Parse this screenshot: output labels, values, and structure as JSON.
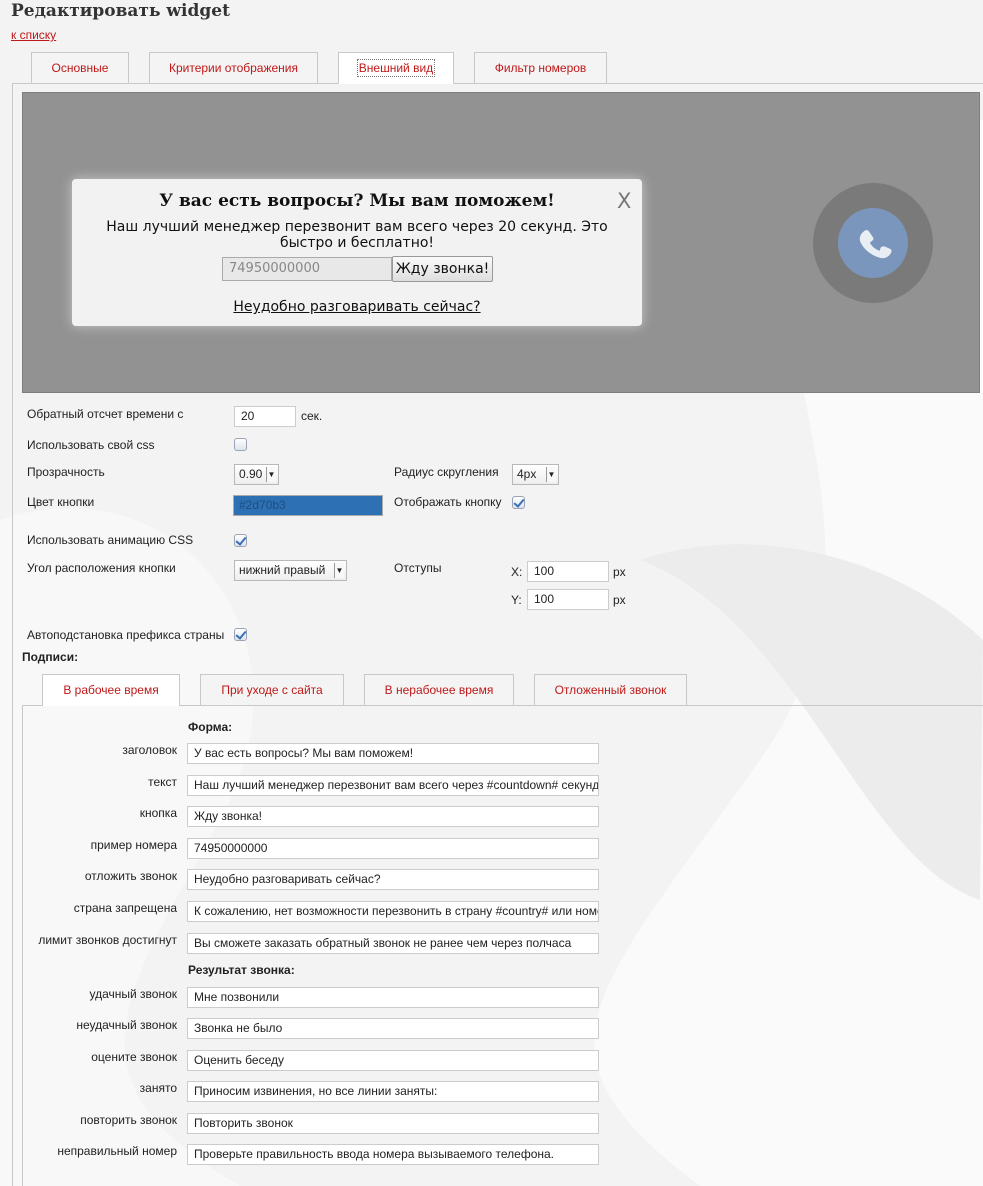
{
  "page": {
    "title": "Редактировать widget",
    "back_link": "к списку"
  },
  "tabs": [
    "Основные",
    "Критерии отображения",
    "Внешний вид",
    "Фильтр номеров"
  ],
  "preview": {
    "title": "У вас есть вопросы? Мы вам поможем!",
    "text": "Наш лучший менеджер перезвонит вам всего через 20 секунд. Это быстро и бесплатно!",
    "phone_placeholder": "74950000000",
    "submit": "Жду звонка!",
    "later": "Неудобно разговаривать сейчас?",
    "close": "X",
    "call_icon": "phone-icon"
  },
  "settings": {
    "countdown_label": "Обратный отсчет времени с",
    "countdown_value": "20",
    "countdown_unit": "сек.",
    "custom_css_label": "Использовать свой css",
    "custom_css_checked": false,
    "opacity_label": "Прозрачность",
    "opacity_value": "0.90",
    "radius_label": "Радиус скругления",
    "radius_value": "4px",
    "color_label": "Цвет кнопки",
    "color_value": "#2d70b3",
    "show_button_label": "Отображать кнопку",
    "show_button_checked": true,
    "animation_label": "Использовать анимацию CSS",
    "animation_checked": true,
    "corner_label": "Угол расположения кнопки",
    "corner_value": "нижний правый",
    "offsets_label": "Отступы",
    "x_label": "X:",
    "x_value": "100",
    "y_label": "Y:",
    "y_value": "100",
    "px": "px",
    "autoprefix_label": "Автоподстановка префикса страны",
    "autoprefix_checked": true
  },
  "captions": {
    "title": "Подписи:",
    "tabs": [
      "В рабочее время",
      "При уходе с сайта",
      "В нерабочее время",
      "Отложенный звонок"
    ],
    "form_title": "Форма:",
    "form": [
      {
        "label": "заголовок",
        "value": "У вас есть вопросы? Мы вам поможем!"
      },
      {
        "label": "текст",
        "value": "Наш лучший менеджер перезвонит вам всего через #countdown# секунд. Это быстро и бесплатно!"
      },
      {
        "label": "кнопка",
        "value": "Жду звонка!"
      },
      {
        "label": "пример номера",
        "value": "74950000000"
      },
      {
        "label": "отложить звонок",
        "value": "Неудобно разговаривать сейчас?"
      },
      {
        "label": "страна запрещена",
        "value": "К сожалению, нет возможности перезвонить в страну #country# или номер"
      },
      {
        "label": "лимит звонков достигнут",
        "value": "Вы сможете заказать обратный звонок не ранее чем через полчаса"
      }
    ],
    "result_title": "Результат звонка:",
    "result": [
      {
        "label": "удачный звонок",
        "value": "Мне позвонили"
      },
      {
        "label": "неудачный звонок",
        "value": "Звонка не было"
      },
      {
        "label": "оцените звонок",
        "value": "Оценить беседу"
      },
      {
        "label": "занято",
        "value": "Приносим извинения, но все линии заняты:"
      },
      {
        "label": "повторить звонок",
        "value": "Повторить звонок"
      },
      {
        "label": "неправильный номер",
        "value": "Проверьте правильность ввода номера вызываемого телефона."
      }
    ]
  },
  "colors": {
    "accent_red": "#c01818",
    "preview_bg": "#929292",
    "call_button": "#7a96bc"
  }
}
